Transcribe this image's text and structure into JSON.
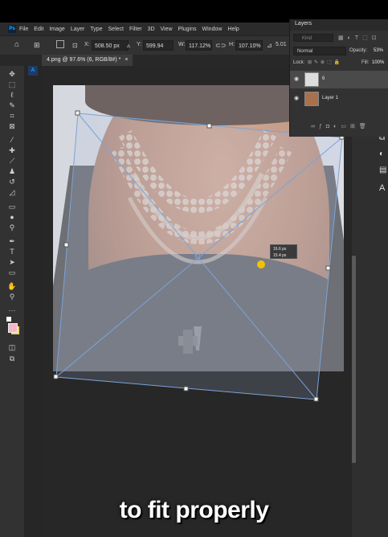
{
  "menubar": {
    "logo": "Ps",
    "items": [
      "File",
      "Edit",
      "Image",
      "Layer",
      "Type",
      "Select",
      "Filter",
      "3D",
      "View",
      "Plugins",
      "Window",
      "Help"
    ]
  },
  "options": {
    "x_label": "X:",
    "x_value": "508.50 px",
    "y_value": "599.94 px",
    "w_label": "W:",
    "w_value": "117.12%",
    "h_label": "H:",
    "h_value": "107.10%",
    "angle_value": "5.01"
  },
  "tab": {
    "title": "4.png @ 97.6% (6, RGB/8#) *",
    "close": "×"
  },
  "layers": {
    "title": "Layers",
    "search_placeholder": "Kind",
    "blend_mode": "Normal",
    "opacity_label": "Opacity:",
    "opacity_value": "53%",
    "lock_label": "Lock:",
    "fill_label": "Fill:",
    "fill_value": "100%",
    "items": [
      {
        "name": "6",
        "visible": true
      },
      {
        "name": "Layer 1",
        "visible": true
      }
    ]
  },
  "transform_tooltip": {
    "line1": "16.6 px",
    "line2": "15.4 px"
  },
  "caption": "to fit properly",
  "colors": {
    "accent": "#31a8ff",
    "cursor": "#f2c200",
    "foreground_swatch": "#f5b6c8",
    "background_swatch": "#e9d36a"
  }
}
